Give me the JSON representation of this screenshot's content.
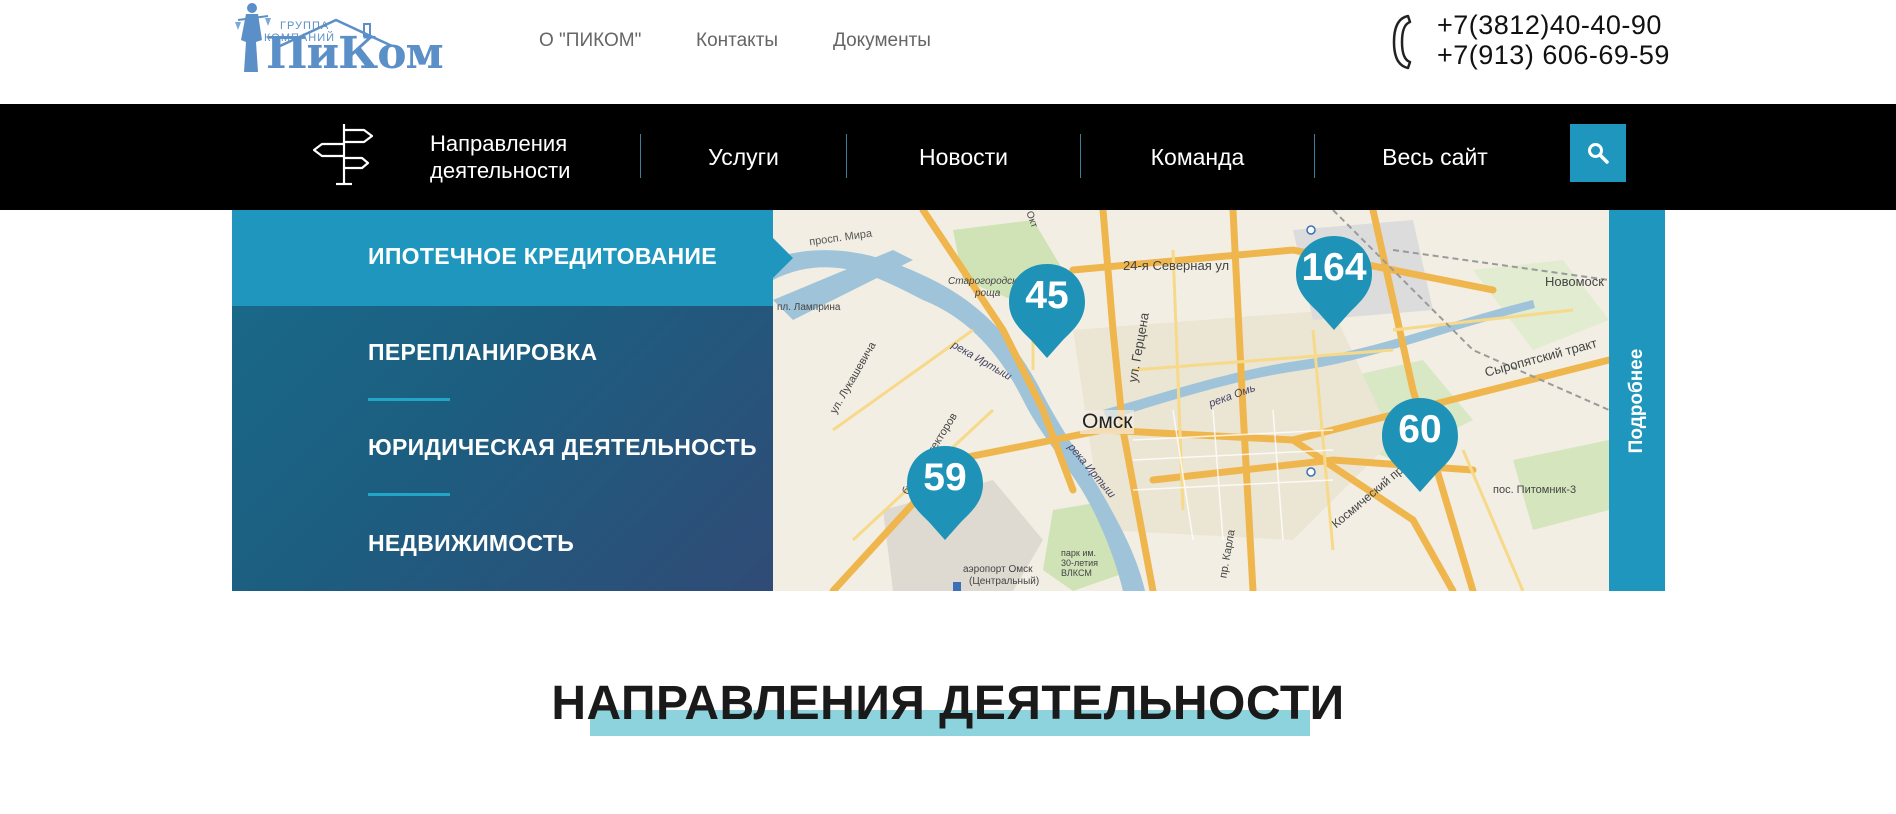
{
  "logo": {
    "line1": "ГРУППА",
    "line2": "КОМПАНИЙ",
    "name": "ПиКом"
  },
  "top_nav": {
    "about": "О \"ПИКОМ\"",
    "contacts": "Контакты",
    "documents": "Документы"
  },
  "phones": {
    "phone1": "+7(3812)40-40-90",
    "phone2": "+7(913) 606-69-59"
  },
  "main_nav": {
    "directions_line1": "Направления",
    "directions_line2": "деятельности",
    "services": "Услуги",
    "news": "Новости",
    "team": "Команда",
    "all_site": "Весь сайт"
  },
  "menu": {
    "items": [
      "ИПОТЕЧНОЕ КРЕДИТОВАНИЕ",
      "ПЕРЕПЛАНИРОВКА",
      "ЮРИДИЧЕСКАЯ ДЕЯТЕЛЬНОСТЬ",
      "НЕДВИЖИМОСТЬ"
    ],
    "active_index": 0
  },
  "map": {
    "city": "Омск",
    "pins": [
      "45",
      "164",
      "60",
      "59"
    ],
    "labels": {
      "mira": "просп. Мира",
      "severnaya": "24-я Северная ул",
      "gertsena": "ул. Герцена",
      "novomoskovsk": "Новомоск",
      "syropyat": "Сыропятский тракт",
      "kosmicheskiy": "Космический пр",
      "pitomnik": "пос. Питомник-3",
      "irtysh1": "река Иртыш",
      "irtysh2": "река Иртыш",
      "om": "река Омь",
      "airport1": "аэропорт Омск",
      "airport2": "(Центральный)",
      "lugansk": "ул. Лукашевича",
      "architect": "бул. Архитекторов",
      "karl": "пр. Карла",
      "park1": "парк им.",
      "park2": "30-летия",
      "park3": "ВЛКСМ",
      "roshcha1": "Старогородская",
      "roshcha2": "роща",
      "lamping": "пл. Ламприна",
      "dekabr": "Окт"
    },
    "more_label": "Подробнее"
  },
  "section": {
    "title": "НАПРАВЛЕНИЯ ДЕЯТЕЛЬНОСТИ"
  },
  "colors": {
    "accent": "#1e96bd",
    "nav_bg": "#000000",
    "underline": "#8dd3de"
  }
}
